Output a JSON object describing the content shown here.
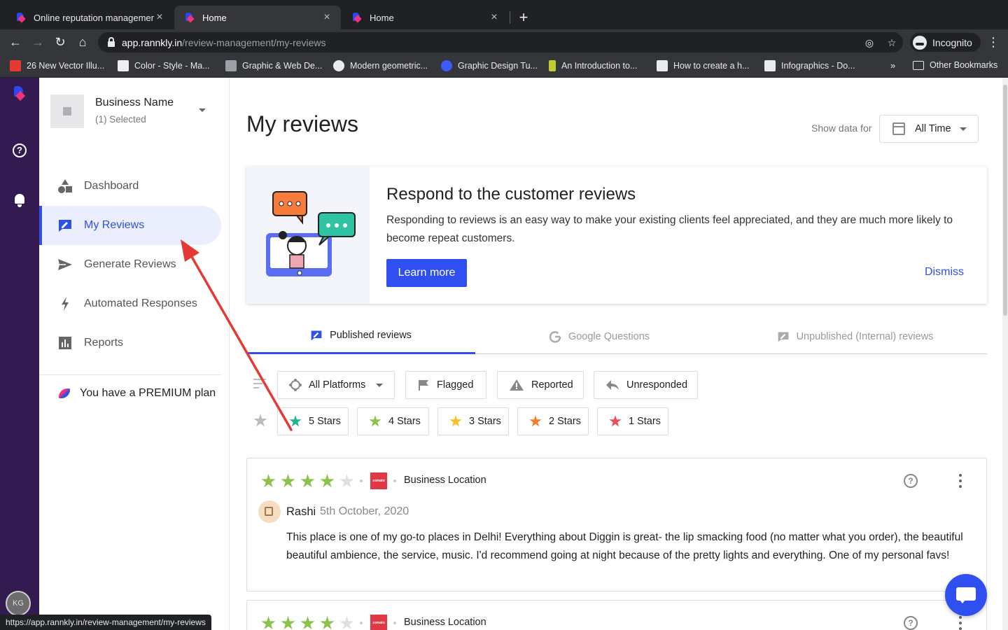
{
  "browser": {
    "tabs": [
      {
        "title": "Online reputation management",
        "active": false
      },
      {
        "title": "Home",
        "active": true
      },
      {
        "title": "Home",
        "active": false
      }
    ],
    "url_host": "app.rannkly.in",
    "url_path": "/review-management/my-reviews",
    "incognito_label": "Incognito",
    "bookmarks": [
      {
        "label": "26 New Vector Illu...",
        "color": "#e53935"
      },
      {
        "label": "Color - Style - Ma...",
        "color": "#eeeeee"
      },
      {
        "label": "Graphic & Web De...",
        "color": "#9aa0a6"
      },
      {
        "label": "Modern geometric...",
        "color": "#e8eaed"
      },
      {
        "label": "Graphic Design Tu...",
        "color": "#3d5afe"
      },
      {
        "label": "An Introduction to...",
        "color": "#c0ca33"
      },
      {
        "label": "How to create a h...",
        "color": "#e8eaed"
      },
      {
        "label": "Infographics - Do...",
        "color": "#e8eaed"
      }
    ],
    "bookmarks_more": "»",
    "other_bookmarks": "Other Bookmarks",
    "status_url": "https://app.rannkly.in/review-management/my-reviews"
  },
  "rail": {
    "avatar_initials": "KG"
  },
  "sidebar": {
    "business_name": "Business Name",
    "business_selected": "(1) Selected",
    "nav": [
      {
        "label": "Dashboard",
        "icon": "shapes-icon",
        "active": false
      },
      {
        "label": "My Reviews",
        "icon": "review-edit-icon",
        "active": true
      },
      {
        "label": "Generate Reviews",
        "icon": "send-icon",
        "active": false
      },
      {
        "label": "Automated Responses",
        "icon": "lightning-icon",
        "active": false
      },
      {
        "label": "Reports",
        "icon": "bar-chart-icon",
        "active": false
      }
    ],
    "premium_prefix": "You have a ",
    "premium_plan": "PREMIUM plan"
  },
  "main": {
    "title": "My reviews",
    "show_data_for": "Show data for",
    "date_range": "All Time",
    "banner": {
      "title": "Respond to the customer reviews",
      "text": "Responding to reviews is an easy way to make your existing clients feel appreciated, and they are much more likely to become repeat customers.",
      "learn_more": "Learn more",
      "dismiss": "Dismiss"
    },
    "tabs": [
      {
        "label": "Published reviews",
        "active": true
      },
      {
        "label": "Google Questions",
        "active": false
      },
      {
        "label": "Unpublished (Internal) reviews",
        "active": false
      }
    ],
    "filters": {
      "platforms": "All Platforms",
      "flagged": "Flagged",
      "reported": "Reported",
      "unresponded": "Unresponded"
    },
    "star_filters": [
      {
        "label": "5 Stars",
        "color": "#1fb48a"
      },
      {
        "label": "4 Stars",
        "color": "#8bc34a"
      },
      {
        "label": "3 Stars",
        "color": "#fbbf24"
      },
      {
        "label": "2 Stars",
        "color": "#f57c29"
      },
      {
        "label": "1 Stars",
        "color": "#ef4b5b"
      }
    ],
    "reviews": [
      {
        "rating": 4,
        "platform_label": "zomato",
        "location": "Business Location",
        "reviewer": "Rashi",
        "date": "5th October, 2020",
        "text": "This place is one of my go-to places in Delhi! Everything about Diggin is great- the lip smacking food (no matter what you order), the beautiful beautiful ambience, the service, music. I'd recommend going at night because of the pretty lights and everything. One of my personal favs!"
      },
      {
        "rating": 4,
        "platform_label": "zomato",
        "location": "Business Location"
      }
    ]
  },
  "colors": {
    "accent": "#2f4ff0",
    "rail": "#331a50",
    "star_filled": "#8bc34a",
    "star_empty": "#e0e0e0",
    "annotation_arrow": "#e53935"
  }
}
